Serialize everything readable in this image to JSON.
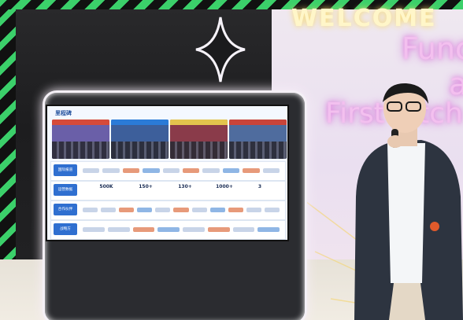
{
  "wall": {
    "welcome_partial": "WELCOME",
    "line1": "Func",
    "line2": "a",
    "line3": "First Pitch"
  },
  "screen": {
    "title": "里程碑",
    "rows": [
      {
        "label": "国际报道"
      },
      {
        "label": "运营数据",
        "stats": [
          {
            "value": "500K"
          },
          {
            "value": "150+"
          },
          {
            "value": "130+"
          },
          {
            "value": "1000+"
          },
          {
            "value": "3"
          }
        ]
      },
      {
        "label": "合作伙伴"
      },
      {
        "label": "战略方"
      }
    ]
  },
  "colors": {
    "stripe_green": "#3bd06a",
    "neon_pink": "#f3c0ef",
    "screen_accent": "#2f6fd0"
  }
}
